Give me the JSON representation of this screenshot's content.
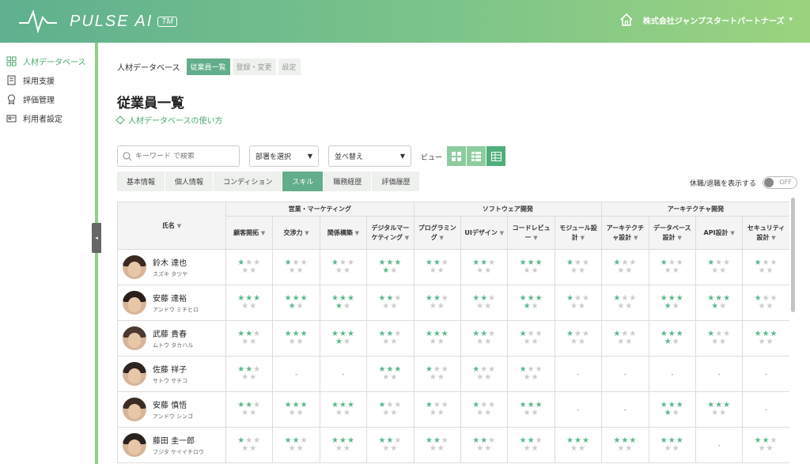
{
  "brand": {
    "name": "PULSE AI",
    "tm": "TM"
  },
  "company": {
    "name": "株式会社ジャンプスタートパートナーズ",
    "caret": "▾"
  },
  "sidebar": {
    "items": [
      {
        "label": "人材データベース",
        "icon": "database-grid-icon",
        "active": true
      },
      {
        "label": "採用支援",
        "icon": "document-icon",
        "active": false
      },
      {
        "label": "評価管理",
        "icon": "award-icon",
        "active": false
      },
      {
        "label": "利用者設定",
        "icon": "user-settings-icon",
        "active": false
      }
    ],
    "collapse": "◂"
  },
  "breadcrumb": {
    "root": "人材データベース",
    "tabs": [
      {
        "label": "従業員一覧",
        "active": true
      },
      {
        "label": "登録・変更",
        "active": false
      },
      {
        "label": "設定",
        "active": false
      }
    ]
  },
  "page": {
    "title": "従業員一覧",
    "help": "人材データベースの使い方"
  },
  "filters": {
    "search_placeholder": "キーワード で検索",
    "department": "部署を選択",
    "sort": "並べ替え",
    "view_label": "ビュー"
  },
  "tabs": [
    {
      "label": "基本情報",
      "active": false
    },
    {
      "label": "個人情報",
      "active": false
    },
    {
      "label": "コンディション",
      "active": false
    },
    {
      "label": "スキル",
      "active": true
    },
    {
      "label": "職務経歴",
      "active": false
    },
    {
      "label": "評価履歴",
      "active": false
    }
  ],
  "toggle": {
    "label": "休職/退職を表示する",
    "state": "OFF"
  },
  "table": {
    "name_header": "氏名",
    "sort_glyph": "▼",
    "groups": [
      {
        "label": "営業・マーケティング",
        "span": 4
      },
      {
        "label": "ソフトウェア開発",
        "span": 4
      },
      {
        "label": "アーキテクチャ開発",
        "span": 4
      }
    ],
    "columns": [
      "顧客開拓",
      "交渉力",
      "関係構築",
      "デジタルマーケティング",
      "プログラミング",
      "UIデザイン",
      "コードレビュー",
      "モジュール設計",
      "アーキテクチャ設計",
      "データベース設計",
      "API設計",
      "セキュリティ設計"
    ],
    "rows": [
      {
        "name": "鈴木 達也",
        "kana": "スズキ タツヤ",
        "skills": [
          1,
          1,
          1,
          4,
          2,
          2,
          3,
          1,
          1,
          1,
          1,
          1
        ]
      },
      {
        "name": "安藤 達裕",
        "kana": "アンドウ ミチヒロ",
        "skills": [
          3,
          4,
          4,
          2,
          2,
          2,
          4,
          1,
          1,
          4,
          4,
          1
        ]
      },
      {
        "name": "武藤 貴春",
        "kana": "ムトウ タカハル",
        "skills": [
          2,
          3,
          4,
          2,
          3,
          2,
          1,
          1,
          1,
          4,
          1,
          3
        ]
      },
      {
        "name": "佐藤 祥子",
        "kana": "サトウ サチコ",
        "skills": [
          2,
          0,
          0,
          3,
          1,
          1,
          1,
          0,
          0,
          0,
          0,
          0
        ]
      },
      {
        "name": "安藤 慎悟",
        "kana": "アンドウ シンゴ",
        "skills": [
          2,
          3,
          3,
          1,
          1,
          1,
          3,
          0,
          0,
          4,
          3,
          0
        ]
      },
      {
        "name": "藤田 圭一郎",
        "kana": "フジタ ケイイチロウ",
        "skills": [
          1,
          2,
          3,
          2,
          2,
          2,
          2,
          3,
          3,
          3,
          0,
          2
        ]
      }
    ],
    "none_glyph": "-"
  },
  "colors": {
    "accent": "#62ad8a",
    "star_on": "#5cb88a",
    "star_off": "#cccccc"
  }
}
